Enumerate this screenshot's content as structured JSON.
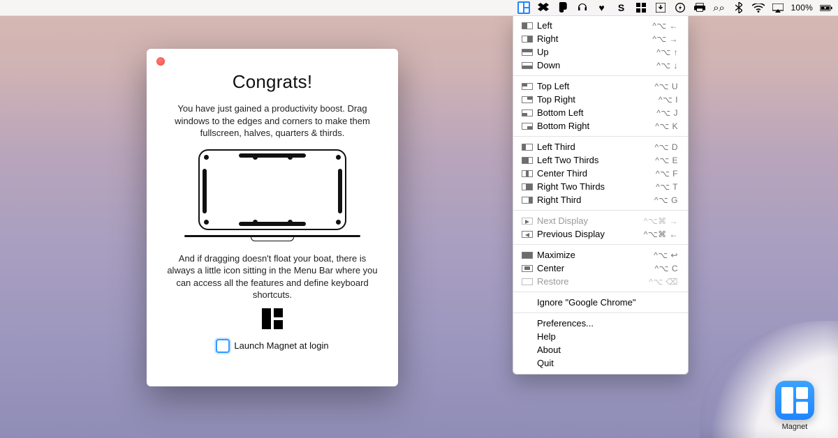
{
  "menubar": {
    "battery_percent": "100%",
    "icons": [
      "magnet-icon",
      "dropbox-icon",
      "evernote-icon",
      "headphones-icon",
      "heart-icon",
      "s-icon",
      "grid-icon",
      "download-icon",
      "bolt-icon",
      "printer-icon",
      "binoculars-icon",
      "bluetooth-icon",
      "wifi-icon",
      "airplay-icon"
    ]
  },
  "dropdown": {
    "groups": [
      [
        {
          "thumb": "half-left",
          "label": "Left",
          "shortcut": "^⌥ ←"
        },
        {
          "thumb": "half-right",
          "label": "Right",
          "shortcut": "^⌥ →"
        },
        {
          "thumb": "half-top",
          "label": "Up",
          "shortcut": "^⌥ ↑"
        },
        {
          "thumb": "half-bot",
          "label": "Down",
          "shortcut": "^⌥ ↓"
        }
      ],
      [
        {
          "thumb": "q-tl",
          "label": "Top Left",
          "shortcut": "^⌥ U"
        },
        {
          "thumb": "q-tr",
          "label": "Top Right",
          "shortcut": "^⌥ I"
        },
        {
          "thumb": "q-bl",
          "label": "Bottom Left",
          "shortcut": "^⌥ J"
        },
        {
          "thumb": "q-br",
          "label": "Bottom Right",
          "shortcut": "^⌥ K"
        }
      ],
      [
        {
          "thumb": "t-1",
          "label": "Left Third",
          "shortcut": "^⌥ D"
        },
        {
          "thumb": "t-12",
          "label": "Left Two Thirds",
          "shortcut": "^⌥ E"
        },
        {
          "thumb": "t-2",
          "label": "Center Third",
          "shortcut": "^⌥ F"
        },
        {
          "thumb": "t-23",
          "label": "Right Two Thirds",
          "shortcut": "^⌥ T"
        },
        {
          "thumb": "t-3",
          "label": "Right Third",
          "shortcut": "^⌥ G"
        }
      ],
      [
        {
          "thumb": "arrow-r none",
          "label": "Next Display",
          "shortcut": "^⌥⌘ →",
          "disabled": true
        },
        {
          "thumb": "arrow-l",
          "label": "Previous Display",
          "shortcut": "^⌥⌘ ←"
        }
      ],
      [
        {
          "thumb": "max",
          "label": "Maximize",
          "shortcut": "^⌥ ↩"
        },
        {
          "thumb": "center",
          "label": "Center",
          "shortcut": "^⌥ C"
        },
        {
          "thumb": "none",
          "label": "Restore",
          "shortcut": "^⌥ ⌫",
          "disabled": true
        }
      ],
      [
        {
          "label": "Ignore \"Google Chrome\""
        }
      ],
      [
        {
          "label": "Preferences..."
        },
        {
          "label": "Help"
        },
        {
          "label": "About"
        },
        {
          "label": "Quit"
        }
      ]
    ]
  },
  "modal": {
    "title": "Congrats!",
    "p1": "You have just gained a productivity boost. Drag windows to the edges and corners to make them fullscreen, halves, quarters & thirds.",
    "p2": "And if dragging doesn't float your boat, there is always a little icon sitting in the Menu Bar where you can access all the features and define keyboard shortcuts.",
    "checkbox_label": "Launch Magnet at login"
  },
  "appicon": {
    "label": "Magnet"
  }
}
